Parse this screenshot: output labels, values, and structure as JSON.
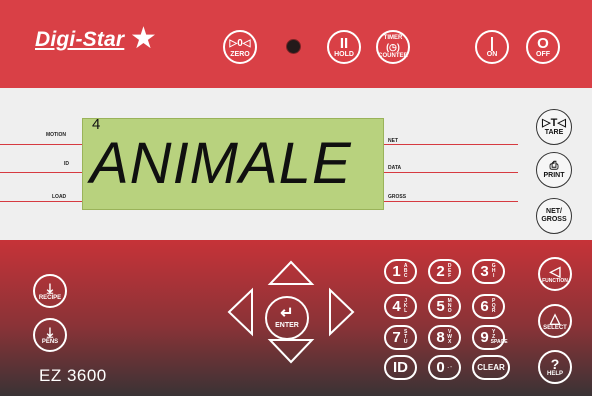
{
  "brand": {
    "name": "Digi-Star",
    "star": "★"
  },
  "model": "EZ 3600",
  "lcd": {
    "digit": "4",
    "text": "ANIMALE",
    "backlight": "#b8d27e"
  },
  "indicators": {
    "left": [
      "MOTION",
      "ID",
      "LOAD"
    ],
    "right": [
      "NET",
      "DATA",
      "GROSS"
    ]
  },
  "top_buttons": [
    {
      "sym": "▷0◁",
      "label": "ZERO"
    },
    {
      "sym": "II",
      "label": "HOLD"
    },
    {
      "sym": "(◷)",
      "label_top": "TIMER",
      "label": "COUNTER"
    },
    {
      "sym": "|",
      "label": "ON"
    },
    {
      "sym": "O",
      "label": "OFF"
    }
  ],
  "side_buttons": [
    {
      "sym": "▷T◁",
      "label": "TARE"
    },
    {
      "sym": "⎙",
      "label": "PRINT"
    },
    {
      "sym": "NET/",
      "label": "GROSS"
    }
  ],
  "left_buttons": [
    {
      "sym": "⤓",
      "label": "RECIPE"
    },
    {
      "sym": "⤓",
      "label": "PENS"
    }
  ],
  "right_buttons": [
    {
      "sym": "◁",
      "label": "FUNCTION"
    },
    {
      "sym": "△",
      "label": "SELECT"
    },
    {
      "sym": "?",
      "label": "HELP"
    }
  ],
  "keypad": [
    {
      "d": "1",
      "sub": "A B C"
    },
    {
      "d": "2",
      "sub": "D E F"
    },
    {
      "d": "3",
      "sub": "G H I"
    },
    {
      "d": "4",
      "sub": "J K L"
    },
    {
      "d": "5",
      "sub": "M N O"
    },
    {
      "d": "6",
      "sub": "P Q R"
    },
    {
      "d": "7",
      "sub": "S T U"
    },
    {
      "d": "8",
      "sub": "V W X"
    },
    {
      "d": "9",
      "sub": "Y Z SPACE"
    },
    {
      "d": "ID",
      "sub": ""
    },
    {
      "d": "0",
      "sub": ". -"
    },
    {
      "d": "CLEAR",
      "sub": ""
    }
  ],
  "enter": {
    "sym": "↵",
    "label": "ENTER"
  },
  "colors": {
    "panel_red": "#d63a40",
    "lcd_green": "#b8d27e",
    "white": "#ffffff"
  }
}
